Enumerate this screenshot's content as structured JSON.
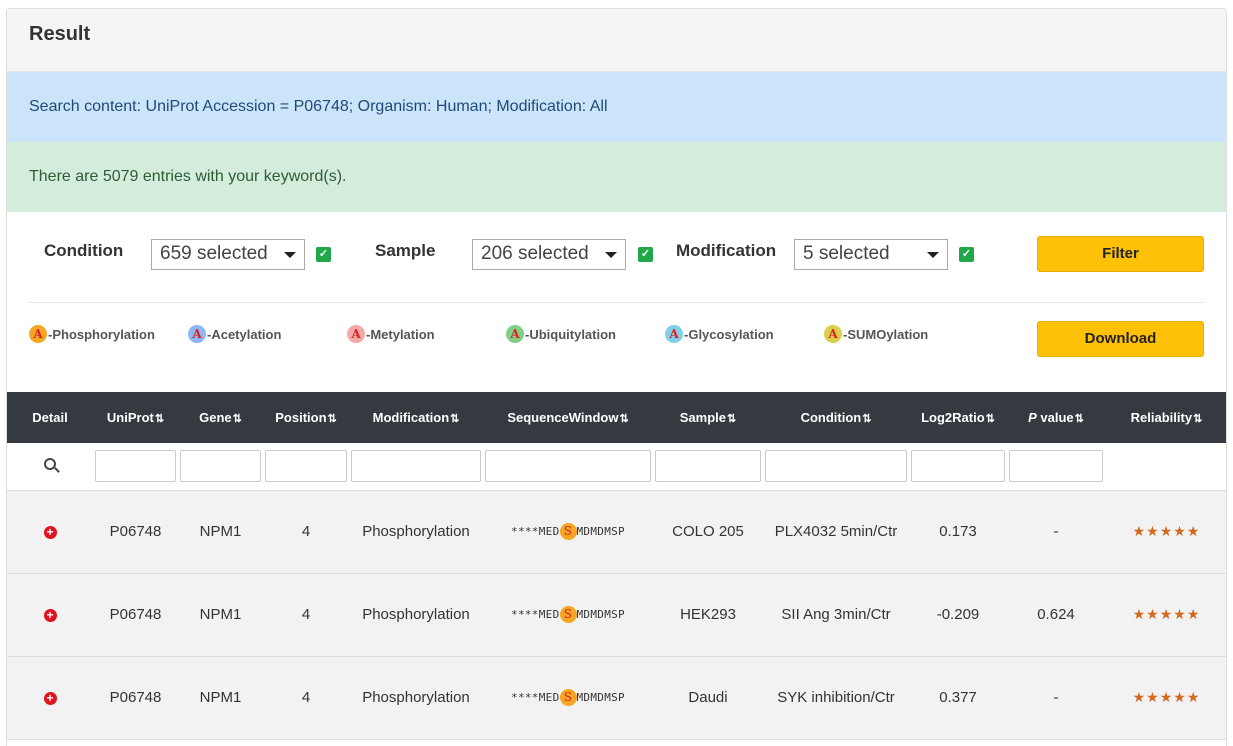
{
  "panel": {
    "title": "Result"
  },
  "alerts": {
    "info": "Search content: UniProt Accession = P06748; Organism: Human; Modification: All",
    "success": "There are 5079 entries with your keyword(s)."
  },
  "filters": {
    "condition_label": "Condition",
    "condition_value": "659 selected",
    "sample_label": "Sample",
    "sample_value": "206 selected",
    "modification_label": "Modification",
    "modification_value": "5 selected",
    "filter_button": "Filter",
    "download_button": "Download"
  },
  "legend": [
    {
      "letter": "A",
      "label": "-Phosphorylation",
      "color": "#f5a623"
    },
    {
      "letter": "A",
      "label": "-Acetylation",
      "color": "#8fb6f0"
    },
    {
      "letter": "A",
      "label": "-Metylation",
      "color": "#f4a9a9"
    },
    {
      "letter": "A",
      "label": "-Ubiquitylation",
      "color": "#7fcf86"
    },
    {
      "letter": "A",
      "label": "-Glycosylation",
      "color": "#7fd0e8"
    },
    {
      "letter": "A",
      "label": "-SUMOylation",
      "color": "#d8d04a"
    }
  ],
  "table": {
    "headers": [
      "Detail",
      "UniProt",
      "Gene",
      "Position",
      "Modification",
      "SequenceWindow",
      "Sample",
      "Condition",
      "Log2Ratio",
      "P",
      " value",
      "Reliability"
    ],
    "sort_icon": "⇅",
    "rows": [
      {
        "uniprot": "P06748",
        "gene": "NPM1",
        "position": "4",
        "modification": "Phosphorylation",
        "seq_before": "****MED",
        "seq_site": "S",
        "seq_after": "MDMDMSP",
        "sample": "COLO 205",
        "condition": "PLX4032 5min/Ctr",
        "log2ratio": "0.173",
        "pvalue": "-",
        "reliability": "★★★★★"
      },
      {
        "uniprot": "P06748",
        "gene": "NPM1",
        "position": "4",
        "modification": "Phosphorylation",
        "seq_before": "****MED",
        "seq_site": "S",
        "seq_after": "MDMDMSP",
        "sample": "HEK293",
        "condition": "SII Ang 3min/Ctr",
        "log2ratio": "-0.209",
        "pvalue": "0.624",
        "reliability": "★★★★★"
      },
      {
        "uniprot": "P06748",
        "gene": "NPM1",
        "position": "4",
        "modification": "Phosphorylation",
        "seq_before": "****MED",
        "seq_site": "S",
        "seq_after": "MDMDMSP",
        "sample": "Daudi",
        "condition": "SYK inhibition/Ctr",
        "log2ratio": "0.377",
        "pvalue": "-",
        "reliability": "★★★★★"
      }
    ]
  }
}
